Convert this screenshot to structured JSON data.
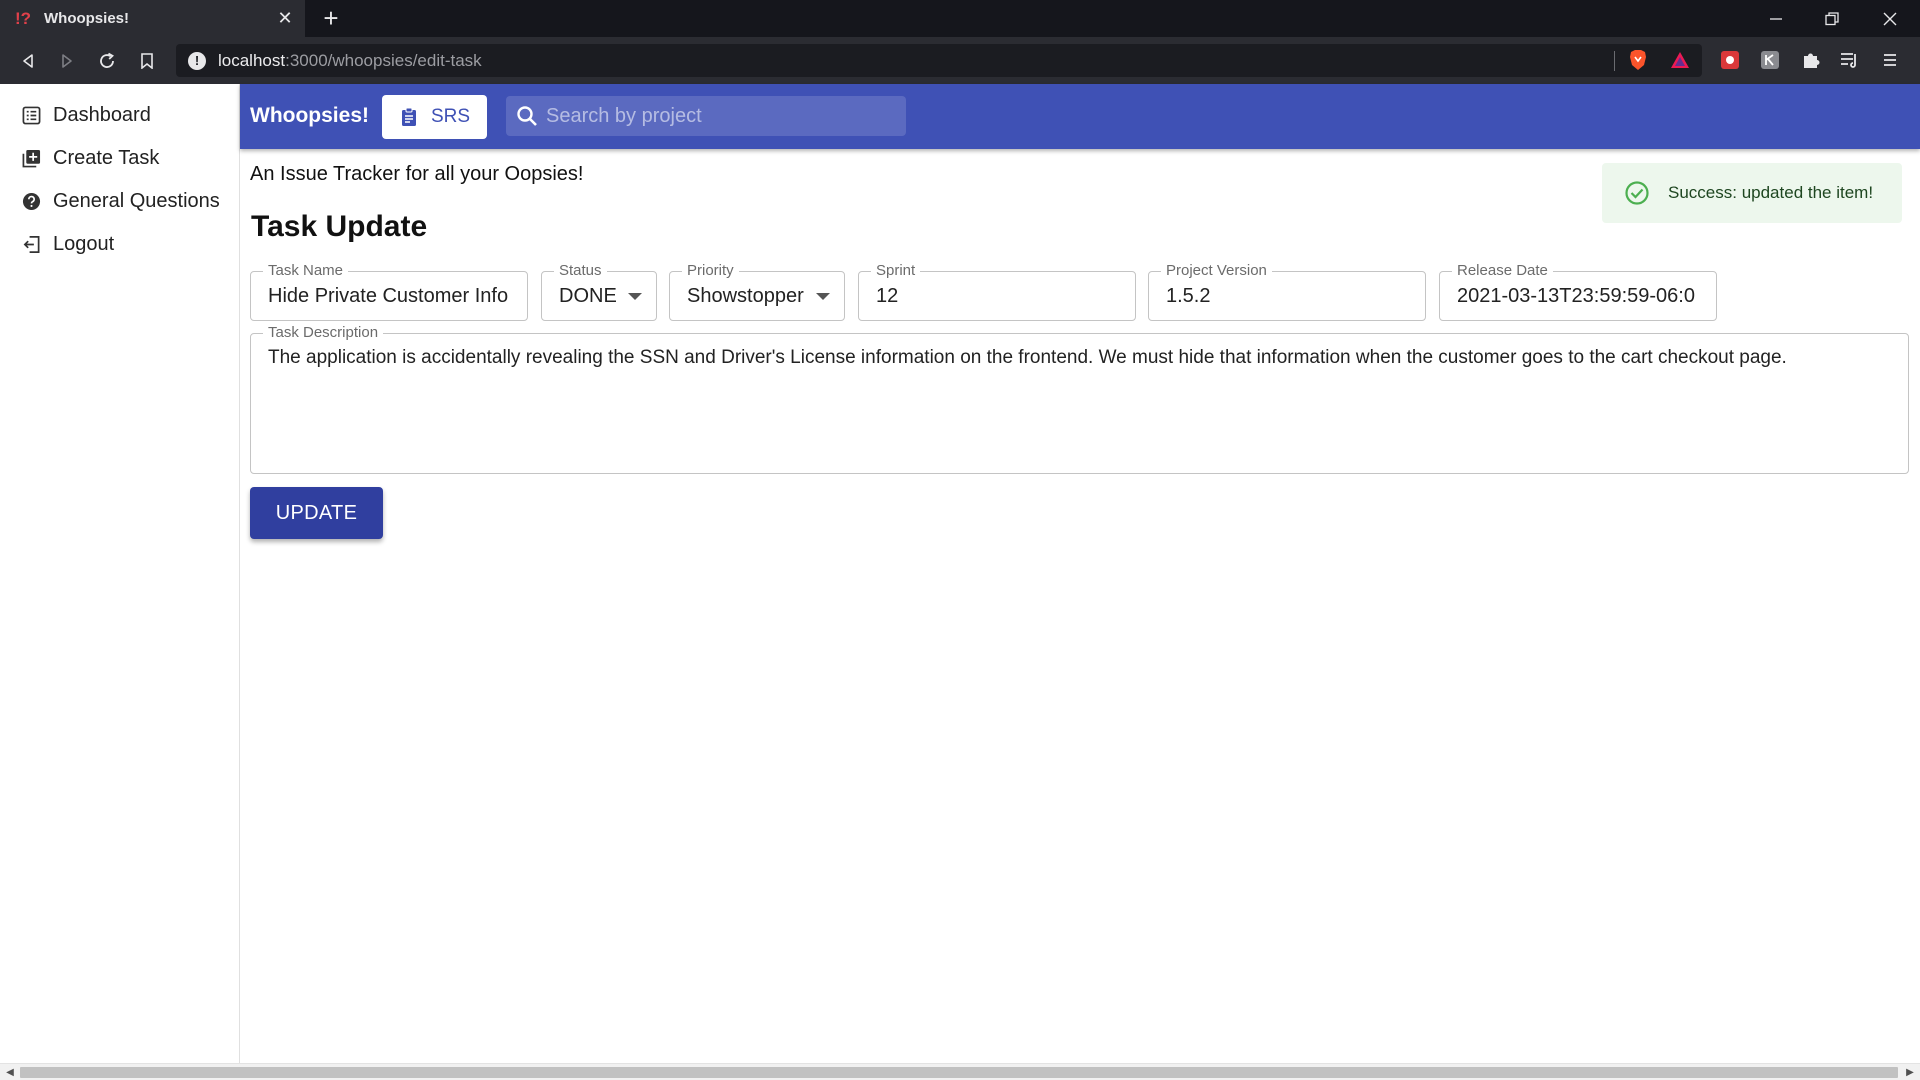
{
  "browser": {
    "tab_title": "Whoopsies!",
    "url_host": "localhost",
    "url_path": ":3000/whoopsies/edit-task"
  },
  "sidebar": {
    "items": [
      {
        "label": "Dashboard",
        "icon": "list-icon"
      },
      {
        "label": "Create Task",
        "icon": "add-box-icon"
      },
      {
        "label": "General Questions",
        "icon": "help-icon"
      },
      {
        "label": "Logout",
        "icon": "logout-icon"
      }
    ]
  },
  "appbar": {
    "brand": "Whoopsies!",
    "srs_label": "SRS",
    "search_placeholder": "Search by project",
    "color": "#3f51b5"
  },
  "main": {
    "tagline": "An Issue Tracker for all your Oopsies!",
    "title": "Task Update",
    "toast": "Success: updated the item!",
    "fields": {
      "task_name": {
        "label": "Task Name",
        "value": "Hide Private Customer Info"
      },
      "status": {
        "label": "Status",
        "value": "DONE"
      },
      "priority": {
        "label": "Priority",
        "value": "Showstopper"
      },
      "sprint": {
        "label": "Sprint",
        "value": "12"
      },
      "project_version": {
        "label": "Project Version",
        "value": "1.5.2"
      },
      "release_date": {
        "label": "Release Date",
        "value": "2021-03-13T23:59:59-06:0"
      }
    },
    "description": {
      "label": "Task Description",
      "value": "The application is accidentally revealing the SSN and Driver's License information on the frontend. We must hide that information when the customer goes to the cart checkout page."
    },
    "update_label": "UPDATE"
  }
}
